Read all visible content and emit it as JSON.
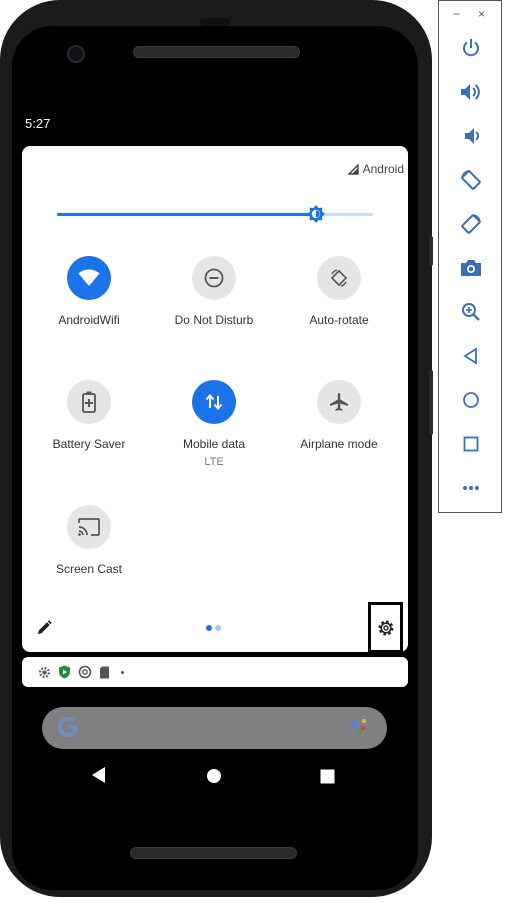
{
  "status_bar": {
    "time": "5:27"
  },
  "quick_settings": {
    "carrier": "Android",
    "brightness_fraction": 0.82,
    "tiles": [
      {
        "label": "AndroidWifi",
        "sub": "",
        "state": "on",
        "icon": "wifi-icon"
      },
      {
        "label": "Do Not Disturb",
        "sub": "",
        "state": "off",
        "icon": "do-not-disturb-icon"
      },
      {
        "label": "Auto-rotate",
        "sub": "",
        "state": "off",
        "icon": "auto-rotate-icon"
      },
      {
        "label": "Battery Saver",
        "sub": "",
        "state": "off",
        "icon": "battery-saver-icon"
      },
      {
        "label": "Mobile data",
        "sub": "LTE",
        "state": "on",
        "icon": "mobile-data-icon"
      },
      {
        "label": "Airplane mode",
        "sub": "",
        "state": "off",
        "icon": "airplane-icon"
      },
      {
        "label": "Screen Cast",
        "sub": "",
        "state": "off",
        "icon": "cast-icon"
      }
    ],
    "page_count": 2,
    "current_page": 1
  },
  "notification_icons": [
    "gear-icon",
    "shield-icon",
    "sync-icon",
    "sd-card-icon",
    "more-dot-icon"
  ],
  "colors": {
    "accent": "#1a73e8",
    "tile_off": "#e5e5e5",
    "panel": "#ffffff"
  },
  "emulator_toolbar": {
    "buttons": [
      "power-icon",
      "volume-up-icon",
      "volume-down-icon",
      "rotate-left-icon",
      "rotate-right-icon",
      "camera-icon",
      "zoom-icon",
      "back-icon",
      "home-icon",
      "overview-icon",
      "more-icon"
    ],
    "minimize": "−",
    "close": "×"
  }
}
